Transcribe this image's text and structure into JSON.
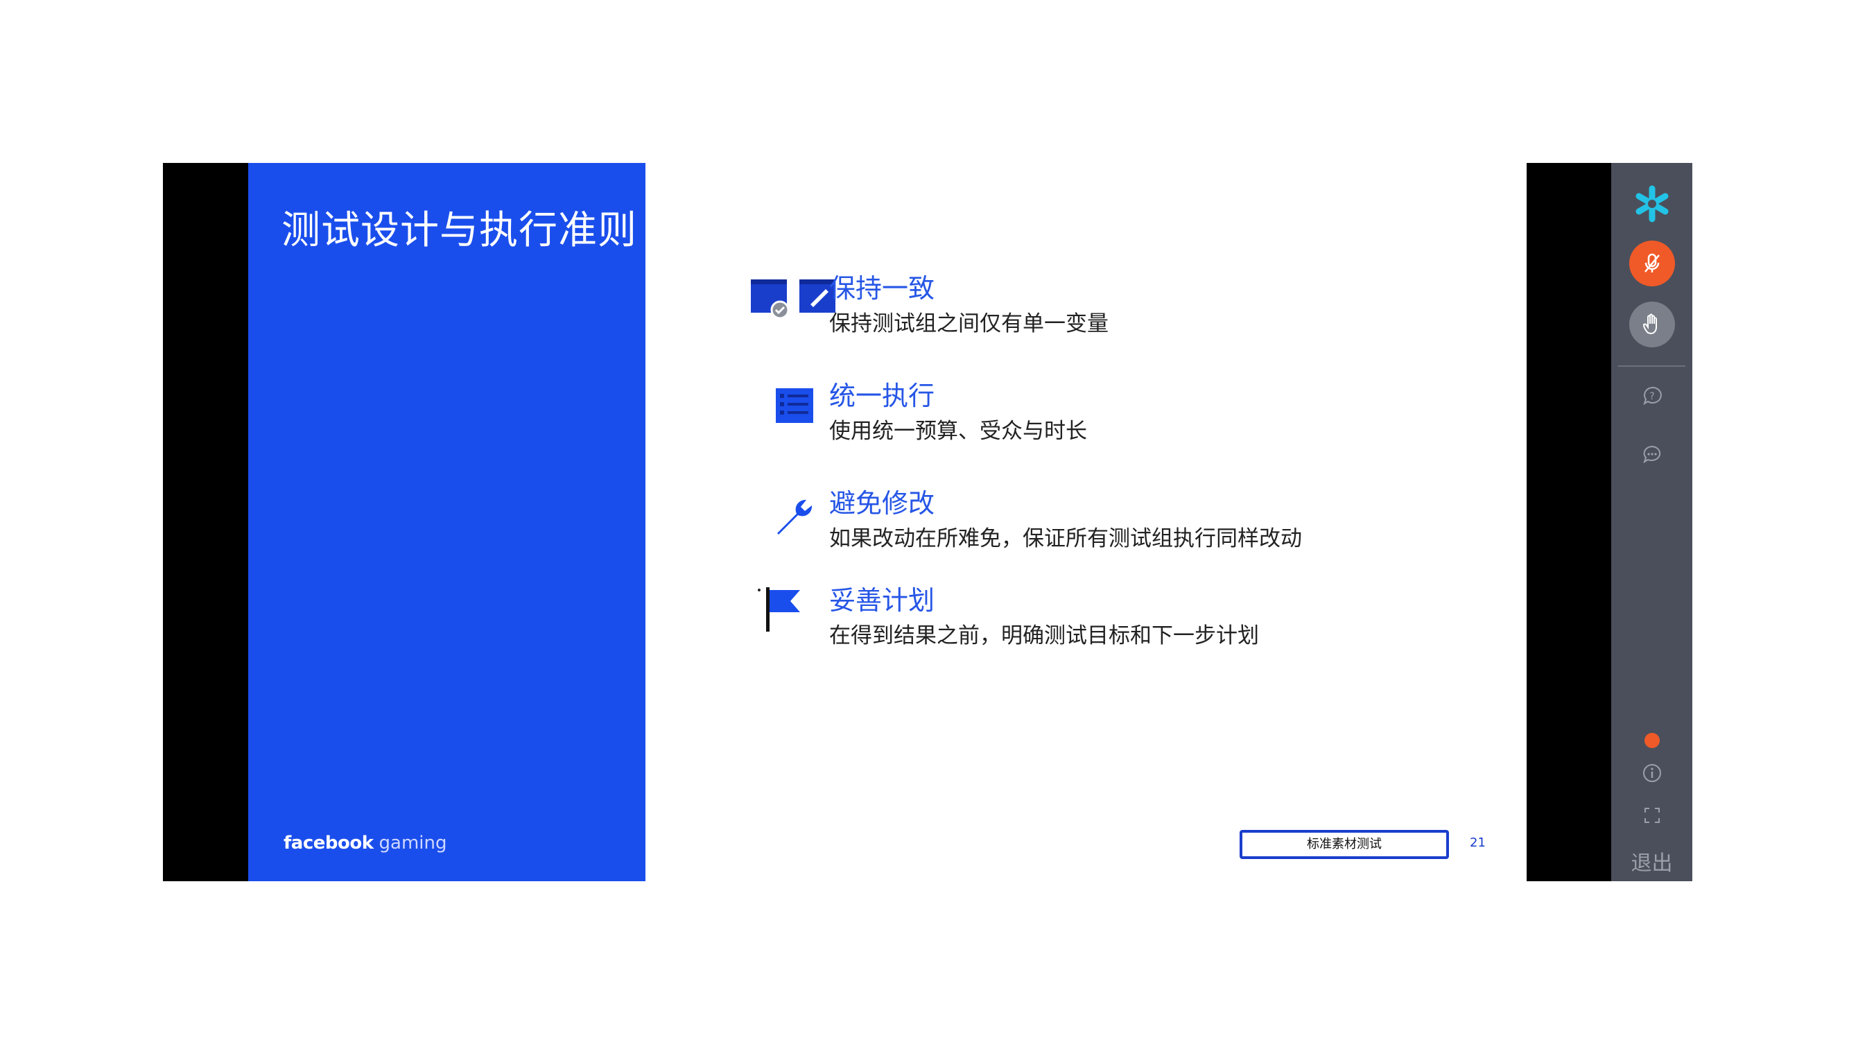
{
  "slide": {
    "title": "测试设计与执行准则",
    "brand": {
      "bold": "facebook",
      "light": "gaming"
    },
    "items": [
      {
        "heading": "保持一致",
        "description": "保持测试组之间仅有单一变量",
        "icon": "windows-check-edit-icon"
      },
      {
        "heading": "统一执行",
        "description": "使用统一预算、受众与时长",
        "icon": "checklist-icon"
      },
      {
        "heading": "避免修改",
        "description": "如果改动在所难免，保证所有测试组执行同样改动",
        "icon": "wrench-icon"
      },
      {
        "heading": "妥善计划",
        "description": "在得到结果之前，明确测试目标和下一步计划",
        "icon": "flag-icon"
      }
    ],
    "tag": "标准素材测试",
    "page_number": "21"
  },
  "toolbar": {
    "exit_label": "退出",
    "icons": [
      "asterisk-logo-icon",
      "microphone-muted-icon",
      "raise-hand-icon",
      "question-icon",
      "chat-icon",
      "status-dot-icon",
      "info-icon",
      "fullscreen-icon"
    ]
  },
  "colors": {
    "slide_blue": "#1a4eec",
    "heading_blue": "#2656e6",
    "mic_orange": "#f05a28",
    "toolbar_bg": "#4b4f5b",
    "logo_cyan": "#22c3e6"
  }
}
